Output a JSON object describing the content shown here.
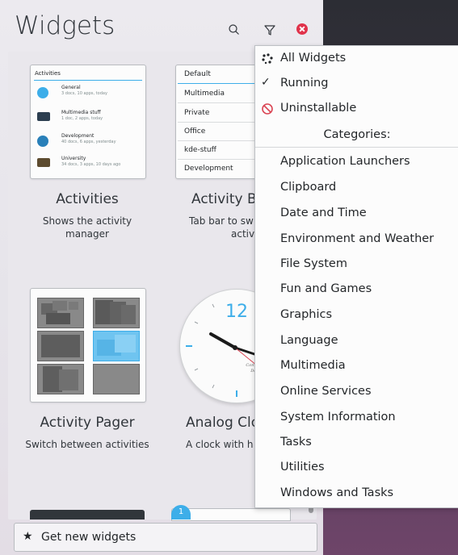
{
  "header": {
    "title": "Widgets"
  },
  "toolbar": {
    "search_icon": "search-icon",
    "filter_icon": "filter-icon",
    "close_icon": "close-icon"
  },
  "widgets": [
    {
      "name": "Activities",
      "desc_line1": "Shows the activity",
      "desc_line2": "manager"
    },
    {
      "name": "Activity Bar",
      "desc_line1": "Tab bar to sw",
      "desc_line2": "activities"
    },
    {
      "name": "Activity Pager",
      "desc_line1": "Switch between activities",
      "desc_line2": ""
    },
    {
      "name": "Analog Clock",
      "desc_line1": "A clock with h",
      "desc_line2": ""
    }
  ],
  "activities_preview": {
    "header": "Activities",
    "items": [
      {
        "title": "General",
        "sub": "3 docs, 10 apps, today",
        "color": "#3daee9"
      },
      {
        "title": "Multimedia stuff",
        "sub": "1 doc, 2 apps, today",
        "color": "#2c3e50"
      },
      {
        "title": "Development",
        "sub": "40 docs, 6 apps, yesterday",
        "color": "#2980b9"
      },
      {
        "title": "University",
        "sub": "34 docs, 3 apps, 10 days ago",
        "color": "#5d4b2f"
      }
    ]
  },
  "activitybar_preview": {
    "items": [
      "Default",
      "Multimedia",
      "Private",
      "Office",
      "kde-stuff",
      "Development"
    ]
  },
  "clock": {
    "hour_label": "12",
    "brand_text_1": "Community",
    "brand_text_2": "Design"
  },
  "bottom": {
    "get_new_label": "Get new widgets",
    "partial_badge": "1"
  },
  "menu": {
    "filters": [
      {
        "label": "All Widgets",
        "icon": "all-widgets-icon"
      },
      {
        "label": "Running",
        "icon": "check-icon"
      },
      {
        "label": "Uninstallable",
        "icon": "forbidden-icon"
      }
    ],
    "categories_header": "Categories:",
    "categories": [
      "Application Launchers",
      "Clipboard",
      "Date and Time",
      "Environment and Weather",
      "File System",
      "Fun and Games",
      "Graphics",
      "Language",
      "Multimedia",
      "Online Services",
      "System Information",
      "Tasks",
      "Utilities",
      "Windows and Tasks"
    ]
  },
  "colors": {
    "accent": "#3daee9",
    "close": "#e0324a",
    "forbidden": "#da4453"
  }
}
